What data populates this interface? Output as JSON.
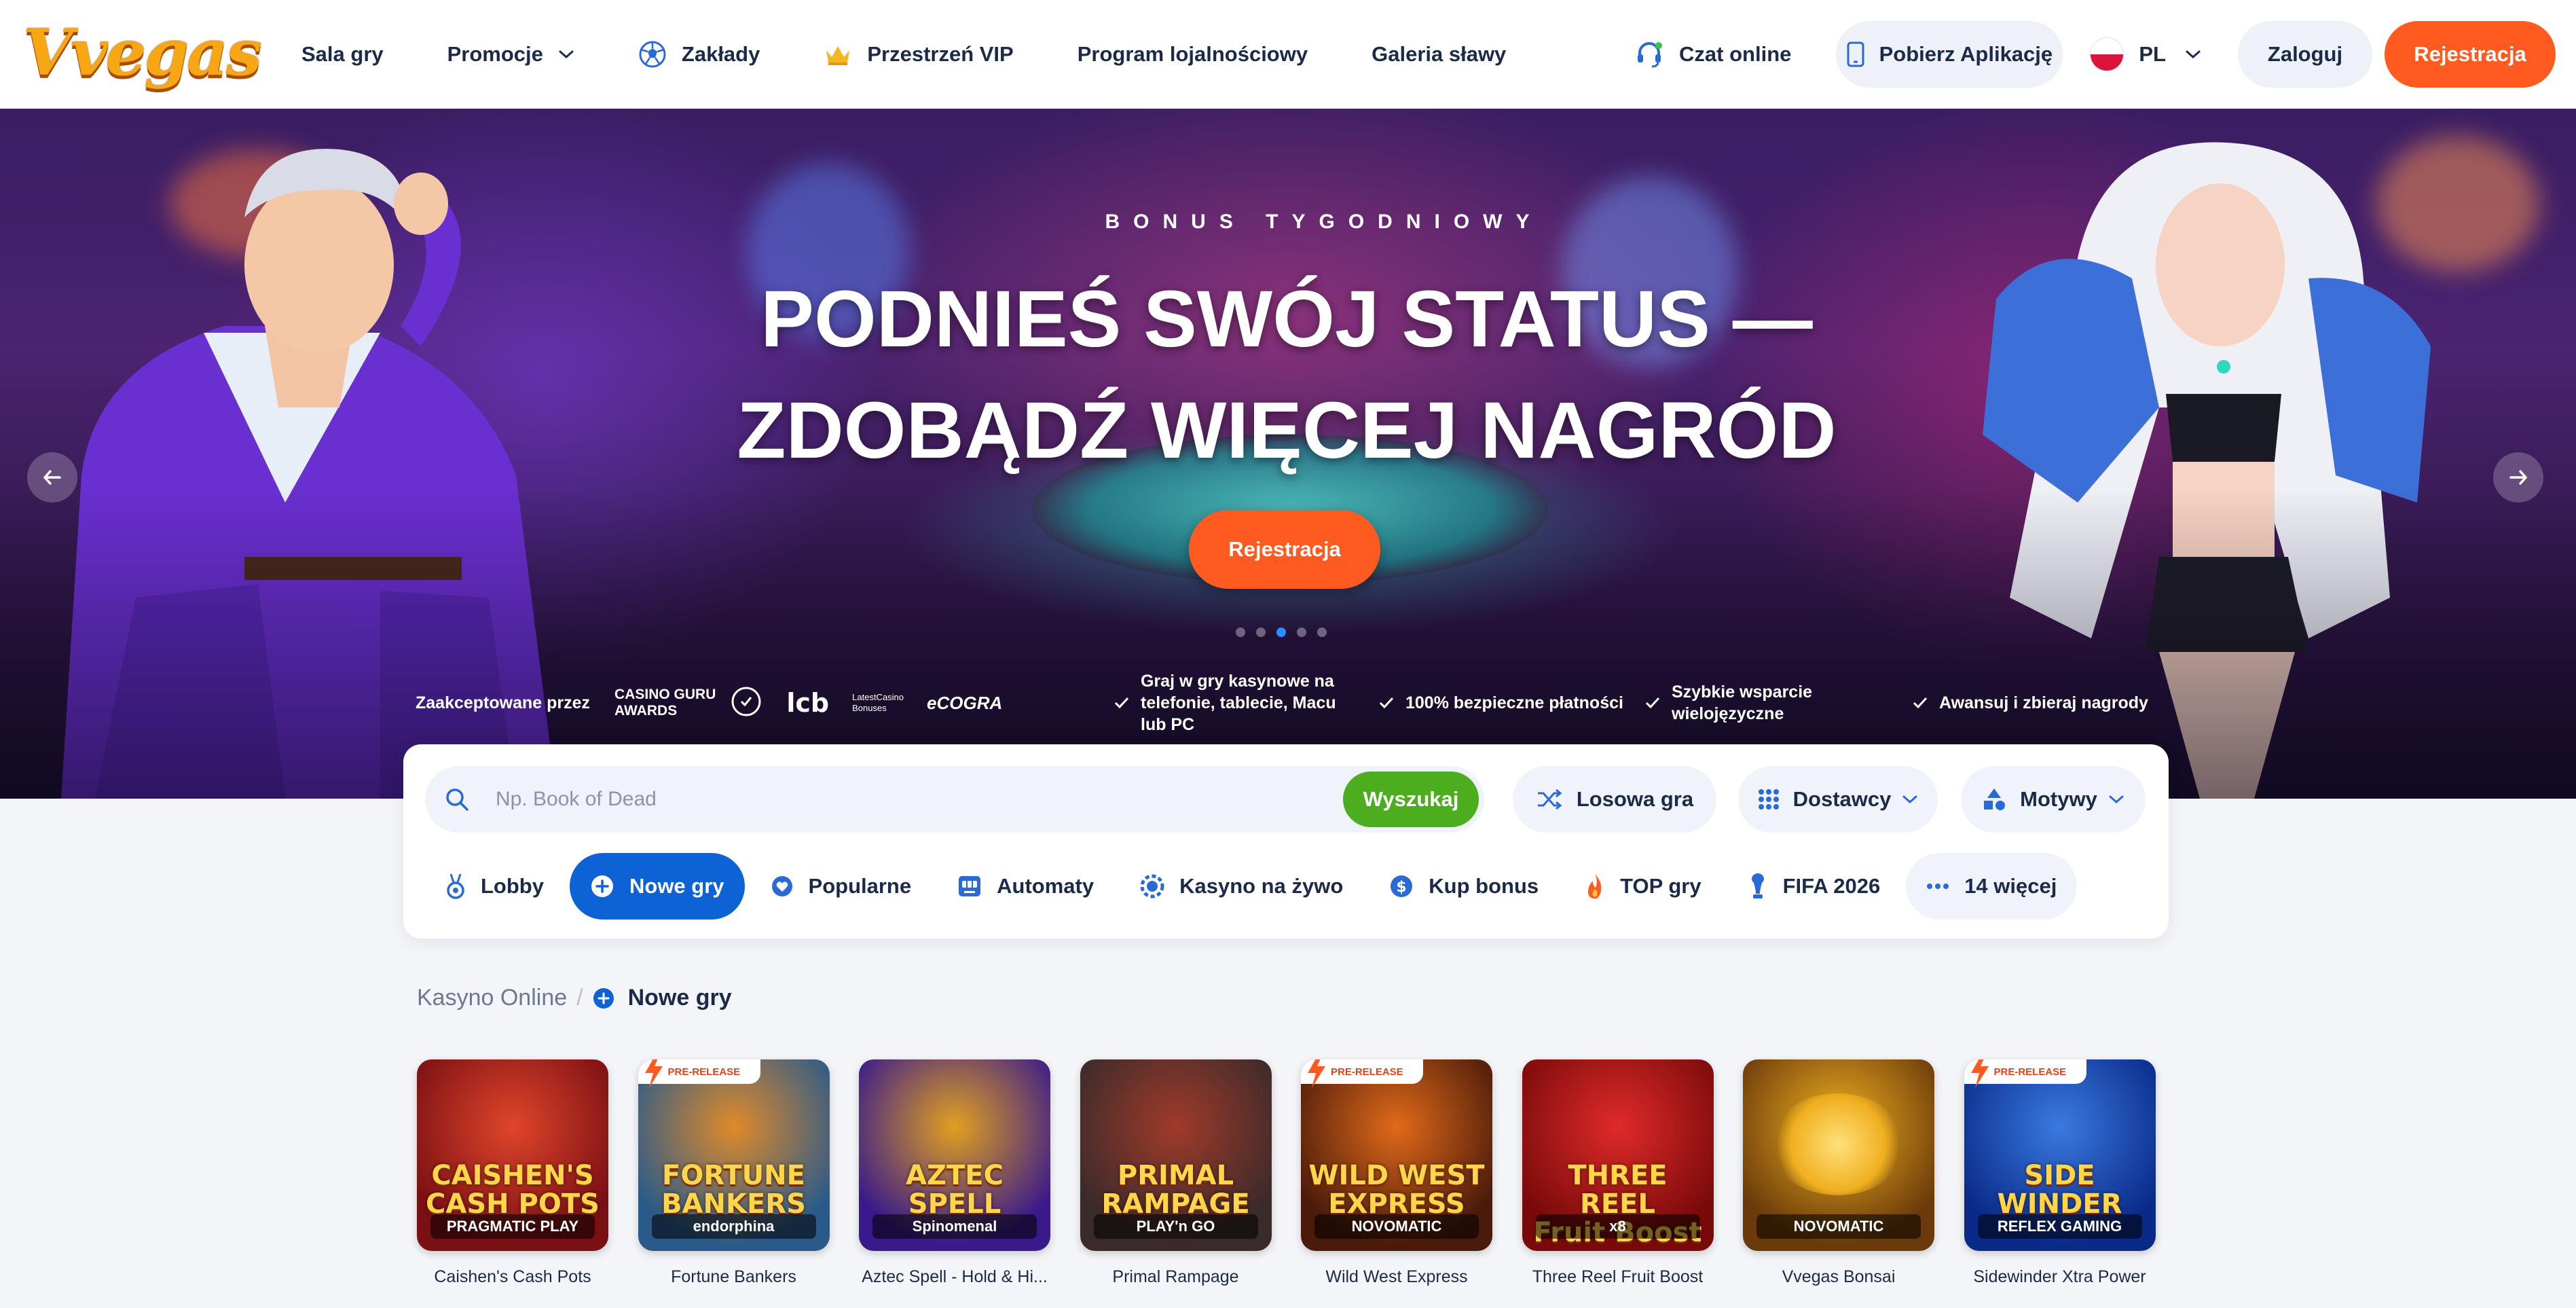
{
  "brand": {
    "logo_text": "Vvegas"
  },
  "nav": {
    "items": [
      {
        "label": "Sala gry"
      },
      {
        "label": "Promocje"
      },
      {
        "label": "Zakłady"
      },
      {
        "label": "Przestrzeń VIP"
      },
      {
        "label": "Program lojalnościowy"
      },
      {
        "label": "Galeria sławy"
      }
    ]
  },
  "header": {
    "chat_label": "Czat online",
    "app_label": "Pobierz Aplikację",
    "lang": "PL",
    "login_label": "Zaloguj",
    "register_label": "Rejestracja"
  },
  "hero": {
    "kicker": "BONUS TYGODNIOWY",
    "title_line1": "PODNIEŚ SWÓJ STATUS —",
    "title_line2": "ZDOBĄDŹ WIĘCEJ NAGRÓD",
    "cta": "Rejestracja",
    "slides_count": 5,
    "active_slide": 3,
    "accepted_label": "Zaakceptowane przez",
    "badges": {
      "casino_guru": "CASINO GURU\nAWARDS",
      "lcb": "lcb",
      "latest": "LatestCasino\nBonuses",
      "ecogra": "eCOGRA"
    },
    "features": [
      "Graj w gry kasynowe na telefonie, tablecie, Macu lub PC",
      "100% bezpieczne płatności",
      "Szybkie wsparcie wielojęzyczne",
      "Awansuj i zbieraj nagrody"
    ]
  },
  "search": {
    "placeholder": "Np. Book of Dead",
    "button": "Wyszukaj",
    "random_game": "Losowa gra",
    "providers": "Dostawcy",
    "themes": "Motywy"
  },
  "categories": [
    {
      "label": "Lobby"
    },
    {
      "label": "Nowe gry",
      "active": true
    },
    {
      "label": "Popularne"
    },
    {
      "label": "Automaty"
    },
    {
      "label": "Kasyno na żywo"
    },
    {
      "label": "Kup bonus"
    },
    {
      "label": "TOP gry"
    },
    {
      "label": "FIFA 2026"
    },
    {
      "label": "14 więcej"
    }
  ],
  "breadcrumb": {
    "home": "Kasyno Online",
    "current": "Nowe gry"
  },
  "games": [
    {
      "name": "Caishen's Cash Pots",
      "art": "CAISHEN'S\nCASH POTS",
      "provider": "PRAGMATIC PLAY",
      "pre_release": "",
      "colors": [
        "#7a0f14",
        "#e0452a"
      ]
    },
    {
      "name": "Fortune Bankers",
      "art": "FORTUNE\nBANKERS",
      "provider": "endorphina",
      "pre_release": "PRE-RELEASE",
      "colors": [
        "#2a5a8a",
        "#e08a2a"
      ]
    },
    {
      "name": "Aztec Spell - Hold & Hi...",
      "art": "AZTEC SPELL",
      "provider": "Spinomenal",
      "pre_release": "",
      "colors": [
        "#3a1a8a",
        "#e0a020"
      ]
    },
    {
      "name": "Primal Rampage",
      "art": "PRIMAL\nRAMPAGE",
      "provider": "PLAY'n GO",
      "pre_release": "",
      "colors": [
        "#3a2a2a",
        "#a03a2a"
      ]
    },
    {
      "name": "Wild West Express",
      "art": "WILD WEST\nEXPRESS",
      "provider": "NOVOMATIC",
      "pre_release": "PRE-RELEASE",
      "colors": [
        "#4a1a0a",
        "#e06a1a"
      ]
    },
    {
      "name": "Three Reel Fruit Boost",
      "art": "THREE REEL\nFruit Boost",
      "provider": "x8",
      "pre_release": "",
      "colors": [
        "#7a0a0a",
        "#e02a2a"
      ]
    },
    {
      "name": "Vvegas Bonsai",
      "art": "",
      "provider": "NOVOMATIC",
      "pre_release": "",
      "colors": [
        "#6a3a0a",
        "#f0b020"
      ]
    },
    {
      "name": "Sidewinder Xtra Power",
      "art": "SIDE\nWINDER",
      "provider": "REFLEX GAMING",
      "pre_release": "PRE-RELEASE",
      "colors": [
        "#0a2a8a",
        "#3a7ae0"
      ]
    }
  ],
  "colors": {
    "accent_orange": "#ff5a1f",
    "accent_blue": "#0d62d6",
    "accent_green": "#4cae1f",
    "text_dark": "#1c2a4a"
  }
}
